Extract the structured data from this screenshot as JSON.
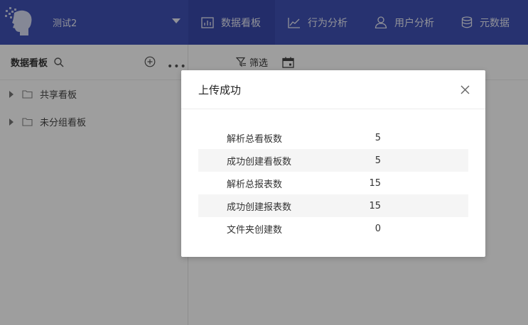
{
  "header": {
    "project_name": "测试2",
    "nav": [
      {
        "label": "数据看板",
        "icon": "bar-chart-icon",
        "active": true
      },
      {
        "label": "行为分析",
        "icon": "line-chart-icon",
        "active": false
      },
      {
        "label": "用户分析",
        "icon": "user-icon",
        "active": false
      },
      {
        "label": "元数据",
        "icon": "database-icon",
        "active": false
      }
    ],
    "brand_color": "#3f51b5"
  },
  "sidebar": {
    "title": "数据看板",
    "tree": [
      {
        "label": "共享看板",
        "icon": "folder-icon"
      },
      {
        "label": "未分组看板",
        "icon": "folder-icon"
      }
    ]
  },
  "toolbar": {
    "filter_label": "筛选"
  },
  "modal": {
    "title": "上传成功",
    "rows": [
      {
        "label": "解析总看板数",
        "value": "5"
      },
      {
        "label": "成功创建看板数",
        "value": "5"
      },
      {
        "label": "解析总报表数",
        "value": "15"
      },
      {
        "label": "成功创建报表数",
        "value": "15"
      },
      {
        "label": "文件夹创建数",
        "value": "0"
      }
    ]
  }
}
